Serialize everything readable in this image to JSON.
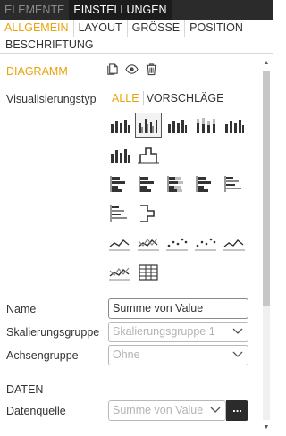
{
  "top_tabs": [
    {
      "label": "ELEMENTE",
      "active": false
    },
    {
      "label": "EINSTELLUNGEN",
      "active": true
    }
  ],
  "sub_tabs": [
    {
      "label": "ALLGEMEIN",
      "active": true
    },
    {
      "label": "LAYOUT",
      "active": false
    },
    {
      "label": "GRÖSSE",
      "active": false
    },
    {
      "label": "POSITION",
      "active": false
    },
    {
      "label": "BESCHRIFTUNG",
      "active": false
    }
  ],
  "diagram": {
    "title": "DIAGRAMM",
    "icons": [
      "copy-icon",
      "eye-icon",
      "trash-icon"
    ]
  },
  "vis_type": {
    "label": "Visualisierungstyp",
    "tabs": [
      {
        "label": "ALLE",
        "active": true
      },
      {
        "label": "VORSCHLÄGE",
        "active": false
      }
    ],
    "selected_icon": "grouped-bar-chart-icon",
    "icons": [
      [
        "bar-chart-icon",
        "grouped-bar-chart-icon",
        "bar-chart-icon",
        "stacked-bar-chart-icon",
        "bar-chart-icon"
      ],
      [
        "bar-chart-icon",
        "waterfall-chart-icon"
      ],
      [
        "horizontal-bar-chart-icon",
        "horizontal-bar-chart-icon",
        "horizontal-bar-chart-icon",
        "horizontal-bar-chart-icon",
        "horizontal-bar-chart-icon"
      ],
      [
        "horizontal-bar-chart-icon",
        "horizontal-waterfall-chart-icon"
      ],
      [
        "line-chart-icon",
        "line-chart-icon",
        "scatter-chart-icon",
        "scatter-chart-icon",
        "line-chart-icon"
      ],
      [
        "line-chart-icon",
        "table-icon"
      ],
      [
        "area-chart-icon",
        "area-chart-icon",
        "area-chart-icon",
        "area-chart-icon"
      ]
    ]
  },
  "fields": {
    "name": {
      "label": "Name",
      "value": "Summe von Value"
    },
    "scaling_group": {
      "label": "Skalierungsgruppe",
      "value": "Skalierungsgruppe 1"
    },
    "axis_group": {
      "label": "Achsengruppe",
      "value": "Ohne"
    }
  },
  "data_section": {
    "title": "DATEN",
    "source": {
      "label": "Datenquelle",
      "value": "Summe von Value",
      "button": "..."
    }
  },
  "colors": {
    "accent": "#e8a40a",
    "dark": "#2b2b2b"
  }
}
